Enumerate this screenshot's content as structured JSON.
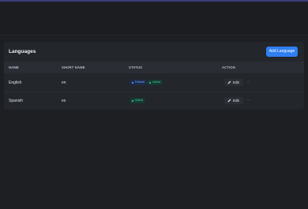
{
  "card": {
    "title": "Languages",
    "add_button": "Add Language"
  },
  "table": {
    "columns": [
      "NAME",
      "SHORT NAME",
      "STATUS",
      "ACTION"
    ],
    "rows": [
      {
        "name": "English",
        "short_name": "en",
        "badges": [
          "Default",
          "Active"
        ],
        "edit_label": "Edit",
        "more_label": "···"
      },
      {
        "name": "Spanish",
        "short_name": "es",
        "badges": [
          "Active"
        ],
        "edit_label": "Edit",
        "more_label": "···"
      }
    ]
  },
  "colors": {
    "accent": "#2f7ff0",
    "badge_default": "#6aa3ff",
    "badge_active": "#3fd19a"
  },
  "icons": {
    "edit": "pencil-icon",
    "more": "more-icon"
  }
}
